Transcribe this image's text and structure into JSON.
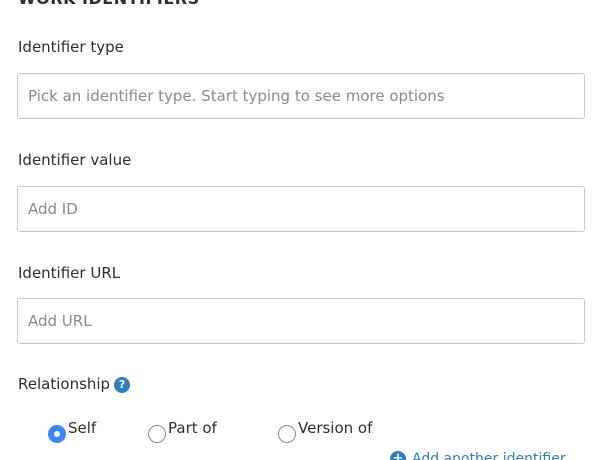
{
  "section": {
    "title": "WORK IDENTIFIERS"
  },
  "fields": {
    "identifier_type": {
      "label": "Identifier type",
      "placeholder": "Pick an identifier type. Start typing to see more options",
      "value": ""
    },
    "identifier_value": {
      "label": "Identifier value",
      "placeholder": "Add ID",
      "value": ""
    },
    "identifier_url": {
      "label": "Identifier URL",
      "placeholder": "Add URL",
      "value": ""
    }
  },
  "relationship": {
    "label": "Relationship",
    "help_icon": "question-circle-icon",
    "options": [
      {
        "label": "Self",
        "selected": true
      },
      {
        "label": "Part of",
        "selected": false
      },
      {
        "label": "Version of",
        "selected": false
      }
    ]
  },
  "add_another": {
    "label": "Add another identifier",
    "icon": "plus-circle-icon"
  },
  "colors": {
    "accent": "#2f7dc1",
    "radio_selected": "#3a86ff",
    "input_border": "#c8c8c8",
    "placeholder": "#8a8a8a",
    "text": "#2e2e2e"
  }
}
